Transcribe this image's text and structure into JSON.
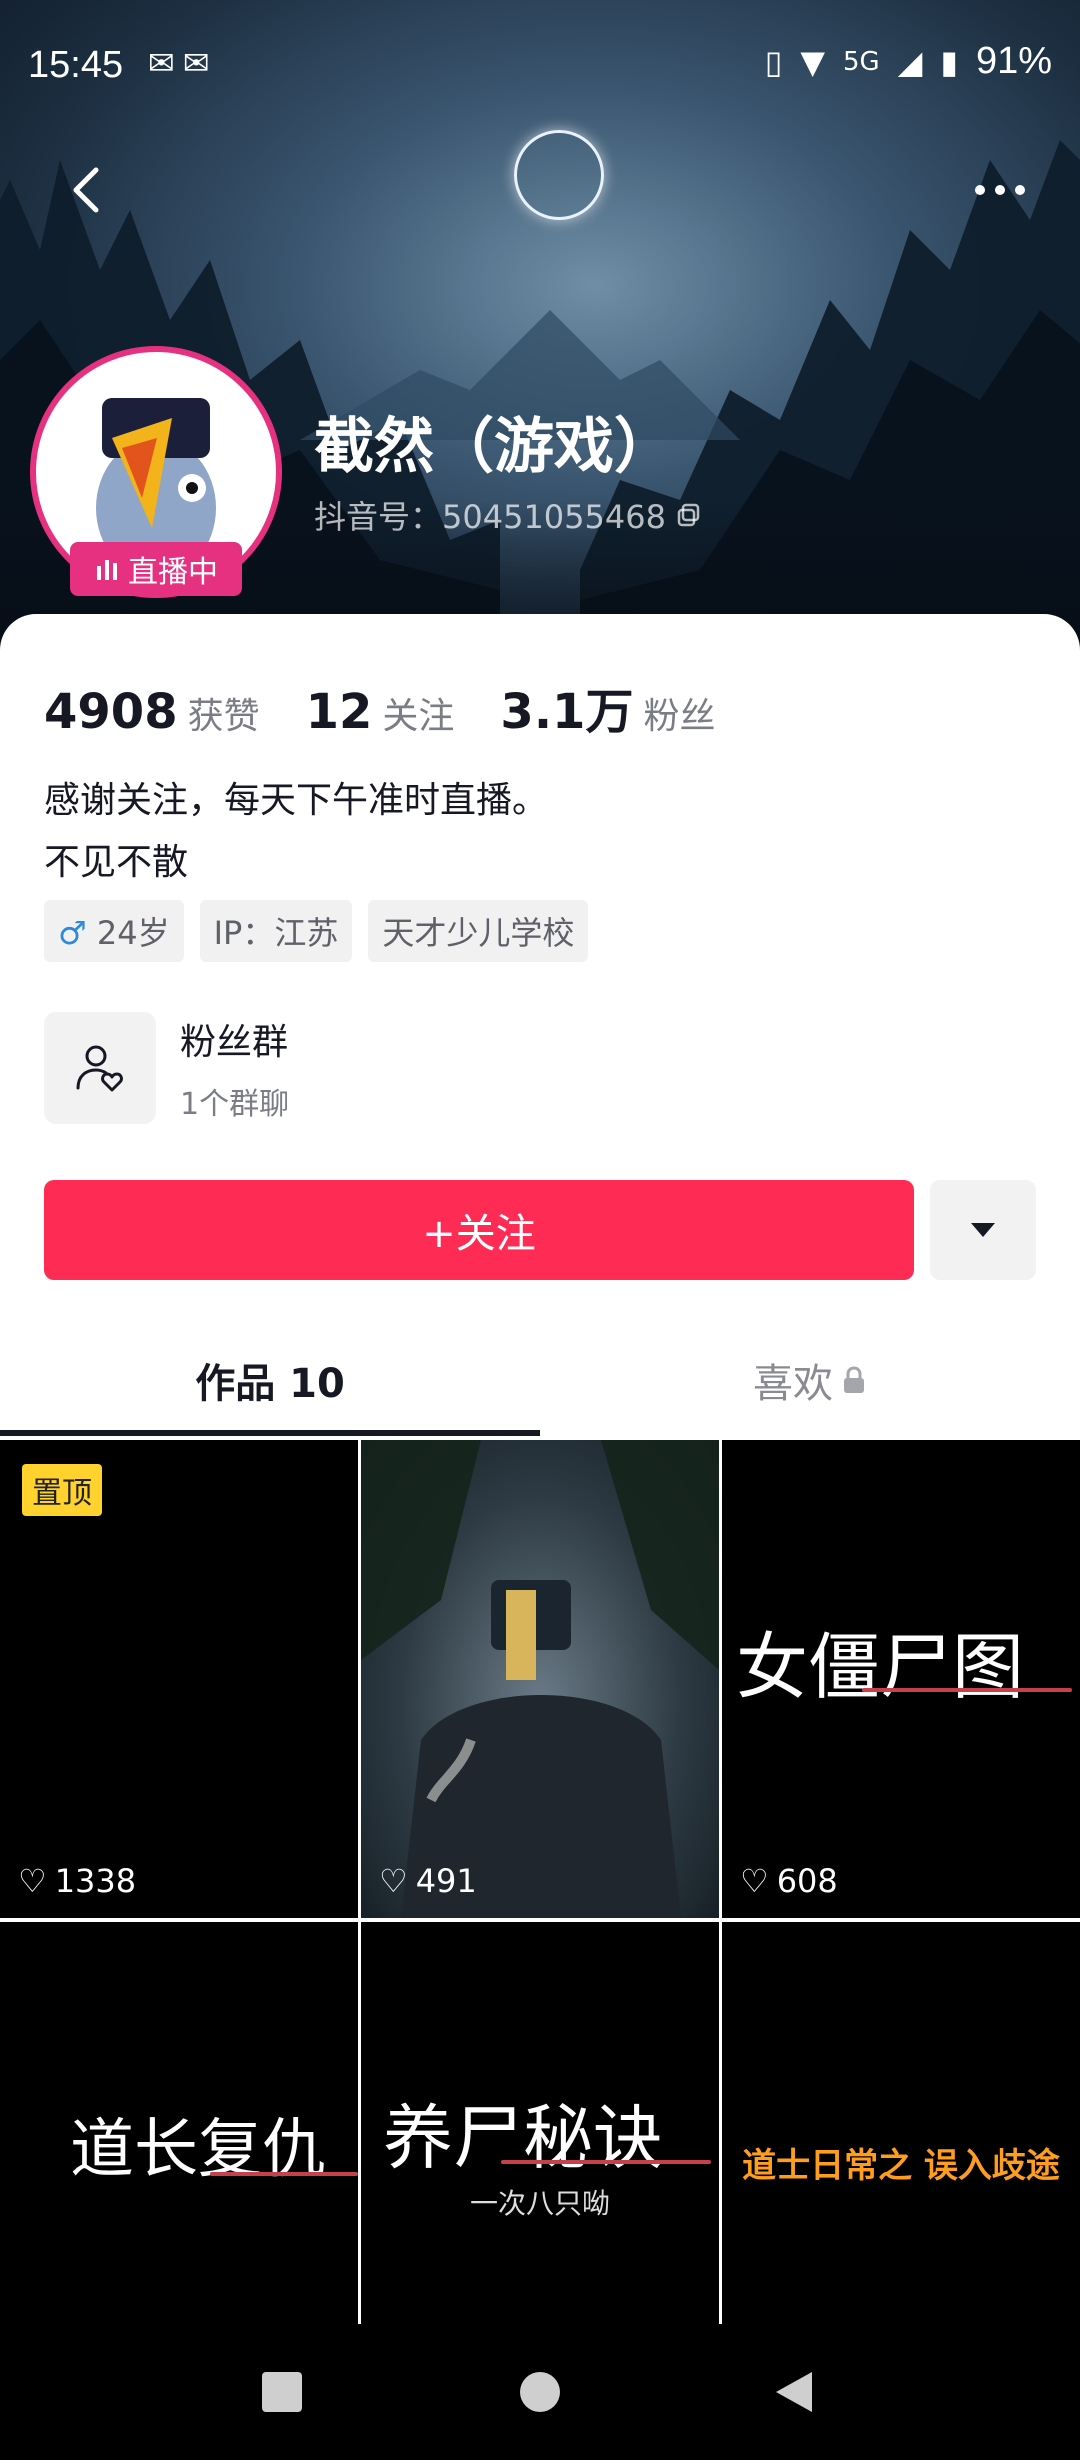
{
  "status_bar": {
    "time": "15:45",
    "network": "5G",
    "battery": "91%"
  },
  "profile": {
    "nickname": "截然（游戏）",
    "douyin_id_label": "抖音号：50451055468",
    "live_badge": "直播中",
    "stats": [
      {
        "value": "4908",
        "label": "获赞"
      },
      {
        "value": "12",
        "label": "关注"
      },
      {
        "value": "3.1万",
        "label": "粉丝"
      }
    ],
    "bio_lines": [
      "感谢关注，每天下午准时直播。",
      "不见不散"
    ],
    "tags": {
      "gender_age": "24岁",
      "ip": "IP：江苏",
      "school": "天才少儿学校"
    },
    "fans_group": {
      "title": "粉丝群",
      "subtitle": "1个群聊"
    },
    "follow_button": "+关注"
  },
  "tabs": {
    "works": "作品 10",
    "likes": "喜欢"
  },
  "videos": [
    {
      "pinned_label": "置顶",
      "likes": "1338"
    },
    {
      "likes": "491"
    },
    {
      "title": "女僵尸图",
      "likes": "608"
    },
    {
      "title": "道长复仇"
    },
    {
      "title": "养尸秘诀",
      "subtitle": "一次八只呦"
    },
    {
      "title": "道士日常之 误入歧途"
    }
  ],
  "colors": {
    "accent": "#fe2c55",
    "live_pink": "#e5317f",
    "pin_yellow": "#ffd22e"
  }
}
